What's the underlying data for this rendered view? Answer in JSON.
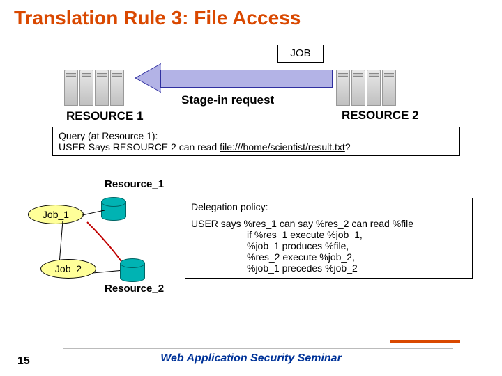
{
  "title": "Translation Rule 3: File Access",
  "job_label": "JOB",
  "stage_in_label": "Stage-in request",
  "resource1_label": "RESOURCE 1",
  "resource2_label": "RESOURCE 2",
  "query": {
    "line1": "Query (at Resource 1):",
    "line2_pre": "USER Says RESOURCE 2 can read ",
    "line2_link": "file:///home/scientist/result.txt",
    "line2_post": "?"
  },
  "lower": {
    "resource1_text": "Resource_1",
    "resource2_text": "Resource_2",
    "job1": "Job_1",
    "job2": "Job_2"
  },
  "policy": {
    "heading": "Delegation policy:",
    "line1": "USER says %res_1 can say %res_2 can read %file",
    "line2": "if %res_1 execute %job_1,",
    "line3": "%job_1 produces %file,",
    "line4": "%res_2 execute %job_2,",
    "line5": "%job_1 precedes %job_2"
  },
  "slide_number": "15",
  "seminar_footer": "Web Application Security Seminar"
}
